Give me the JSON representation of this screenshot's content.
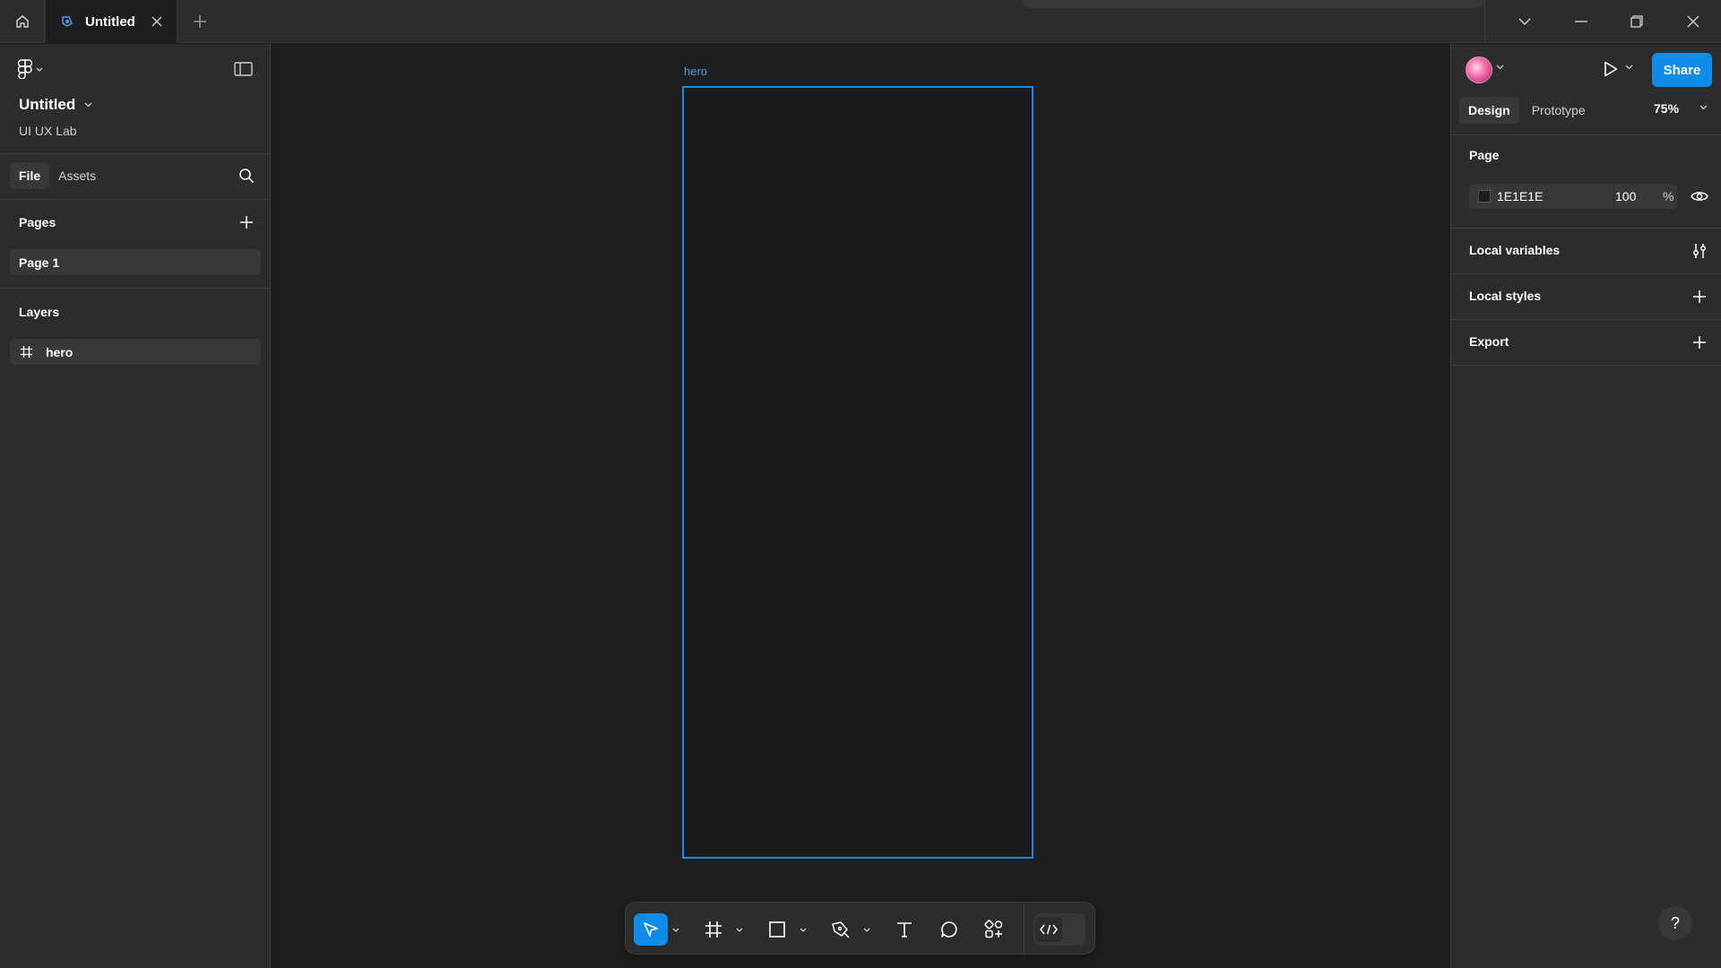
{
  "titlebar": {
    "tab_label": "Untitled"
  },
  "file": {
    "name": "Untitled",
    "team": "UI UX Lab"
  },
  "left_panel": {
    "tabs": [
      {
        "label": "File",
        "active": true
      },
      {
        "label": "Assets",
        "active": false
      }
    ],
    "pages_title": "Pages",
    "pages": [
      "Page 1"
    ],
    "layers_title": "Layers",
    "layers": [
      {
        "name": "hero",
        "icon": "frame-icon"
      }
    ]
  },
  "canvas": {
    "frame_label": "hero",
    "frame_border_color": "#0d8ce9",
    "background_color": "#1e1e1e"
  },
  "toolbar": {
    "tools": [
      "move-tool",
      "frame-tool",
      "rectangle-tool",
      "pen-tool",
      "text-tool",
      "comment-tool",
      "actions-tool",
      "dev-mode-toggle"
    ],
    "active_tool": "move-tool",
    "accent": "#0d8ce9"
  },
  "right_panel": {
    "share_label": "Share",
    "tabs": [
      {
        "label": "Design",
        "active": true
      },
      {
        "label": "Prototype",
        "active": false
      }
    ],
    "zoom": "75%",
    "page_section_title": "Page",
    "page_fill_hex": "1E1E1E",
    "page_fill_opacity": "100",
    "page_fill_unit": "%",
    "local_variables": "Local variables",
    "local_styles": "Local styles",
    "export": "Export",
    "help_label": "?"
  }
}
